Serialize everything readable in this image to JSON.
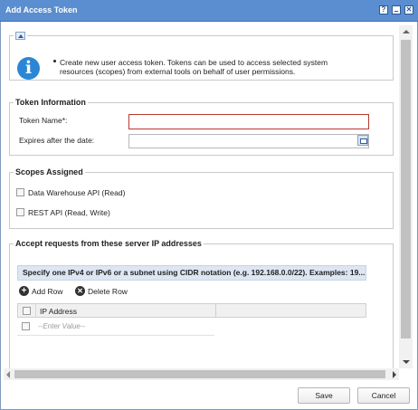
{
  "window": {
    "title": "Add Access Token",
    "controls": {
      "help": "?",
      "minimize": "−",
      "close": "✕"
    }
  },
  "info": {
    "icon": "info-icon",
    "text": "Create new user access token. Tokens can be used to access selected system resources (scopes) from external tools on behalf of user permissions."
  },
  "token_info": {
    "legend": "Token Information",
    "name_label": "Token Name*:",
    "name_value": "",
    "expires_label": "Expires after the date:",
    "expires_value": ""
  },
  "scopes": {
    "legend": "Scopes Assigned",
    "items": [
      {
        "label": "Data Warehouse API (Read)",
        "checked": false
      },
      {
        "label": "REST API (Read, Write)",
        "checked": false
      }
    ]
  },
  "ip_section": {
    "legend": "Accept requests from these server IP addresses",
    "grid_header": "Specify one IPv4 or IPv6 or a subnet using CIDR notation (e.g. 192.168.0.0/22). Examples: 19...",
    "add_row": "Add Row",
    "delete_row": "Delete Row",
    "column_header": "IP Address",
    "row_placeholder": "--Enter Value--"
  },
  "footer": {
    "save": "Save",
    "cancel": "Cancel"
  }
}
